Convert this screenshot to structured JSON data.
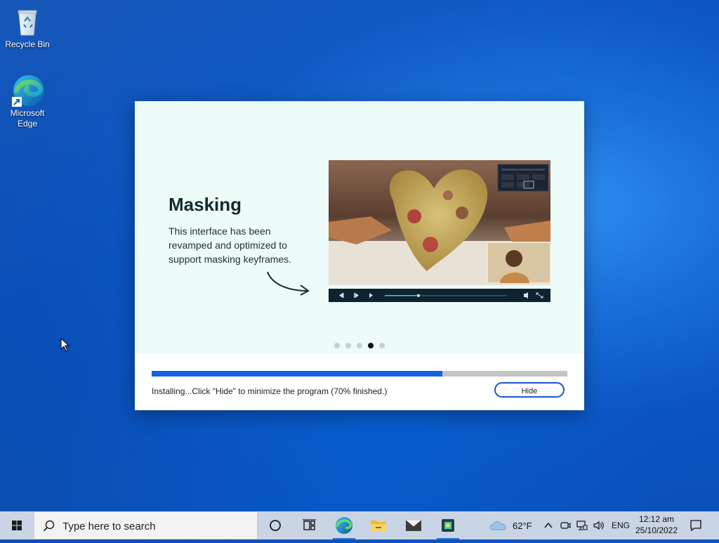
{
  "desktop": {
    "icons": [
      {
        "label": "Recycle Bin",
        "icon": "recycle-bin-icon"
      },
      {
        "label": "Microsoft Edge",
        "icon": "edge-icon"
      }
    ]
  },
  "installer": {
    "slide": {
      "title": "Masking",
      "description": "This interface has been revamped and optimized to support masking keyframes.",
      "carousel_total": 5,
      "carousel_active": 4
    },
    "progress": {
      "fraction": 0.7,
      "status": "Installing...Click \"Hide\" to minimize the program (70% finished.)"
    },
    "hide_label": "Hide"
  },
  "taskbar": {
    "search_placeholder": "Type here to search",
    "apps": [
      "cortana-icon",
      "task-view-icon",
      "edge-icon",
      "file-explorer-icon",
      "mail-icon",
      "installer-icon"
    ],
    "weather": {
      "temp": "62°F",
      "icon": "cloud-icon"
    },
    "language": "ENG",
    "time": "12:12 am",
    "date": "25/10/2022"
  },
  "colors": {
    "accent": "#1463e0",
    "hide_border": "#1b57c8",
    "slide_bg": "#eefcf9"
  }
}
